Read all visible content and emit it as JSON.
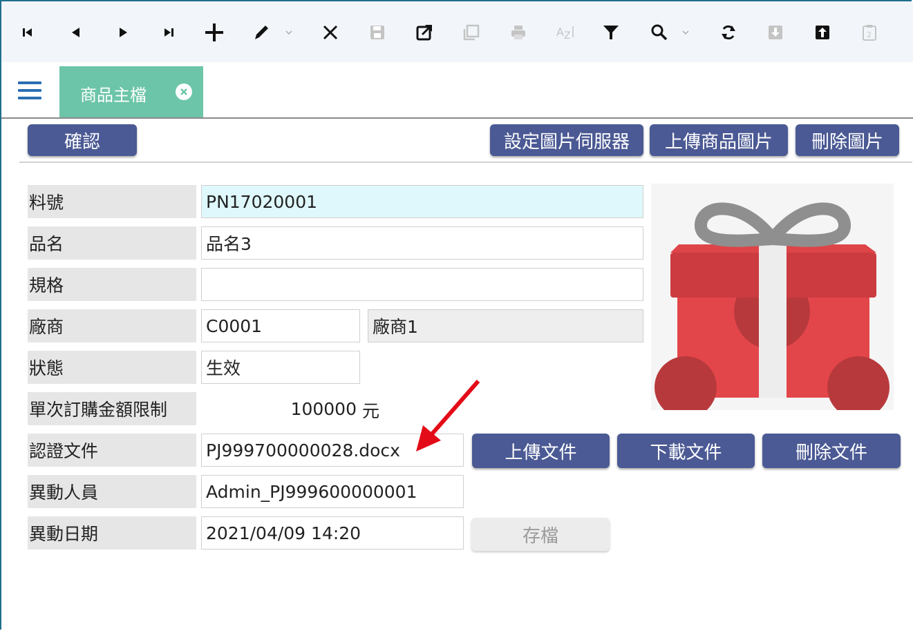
{
  "colors": {
    "accent": "#4b5a94",
    "tab": "#6cc5a8",
    "highlight_field": "#dff8fb",
    "arrow": "#e30b17"
  },
  "toolbar": {
    "icons": [
      "first-icon",
      "prev-icon",
      "next-icon",
      "last-icon",
      "add-icon",
      "edit-icon",
      "delete-icon",
      "save-icon",
      "open-external-icon",
      "copy-icon",
      "print-icon",
      "sort-az-icon",
      "filter-icon",
      "search-icon",
      "refresh-icon",
      "download-icon",
      "upload-icon",
      "clipboard-icon"
    ]
  },
  "tab": {
    "label": "商品主檔"
  },
  "buttons": {
    "confirm": "確認",
    "set_image_server": "設定圖片伺服器",
    "upload_product_image": "上傳商品圖片",
    "delete_image": "刪除圖片",
    "upload_document": "上傳文件",
    "download_document": "下載文件",
    "delete_document": "刪除文件",
    "save": "存檔"
  },
  "form": {
    "part_no": {
      "label": "料號",
      "value": "PN17020001"
    },
    "name": {
      "label": "品名",
      "value": "品名3"
    },
    "spec": {
      "label": "規格",
      "value": ""
    },
    "vendor": {
      "label": "廠商",
      "code": "C0001",
      "name": "廠商1"
    },
    "status": {
      "label": "狀態",
      "value": "生效"
    },
    "order_limit": {
      "label": "單次訂購金額限制",
      "value": "100000",
      "unit": "元"
    },
    "cert_doc": {
      "label": "認證文件",
      "value": "PJ999700000028.docx"
    },
    "modified_by": {
      "label": "異動人員",
      "value": "Admin_PJ999600000001"
    },
    "modified_date": {
      "label": "異動日期",
      "value": "2021/04/09 14:20"
    }
  }
}
